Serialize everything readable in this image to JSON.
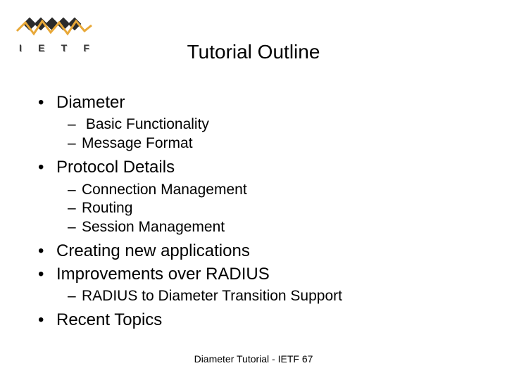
{
  "title": "Tutorial Outline",
  "logo_letters": [
    "I",
    "E",
    "T",
    "F"
  ],
  "bullets": [
    {
      "text": "Diameter",
      "sub": [
        " Basic Functionality",
        "Message Format"
      ]
    },
    {
      "text": "Protocol Details",
      "sub": [
        "Connection Management",
        "Routing",
        "Session Management"
      ]
    },
    {
      "text": "Creating new applications",
      "sub": []
    },
    {
      "text": "Improvements over RADIUS",
      "sub": [
        "RADIUS to Diameter Transition Support"
      ]
    },
    {
      "text": "Recent Topics",
      "sub": []
    }
  ],
  "footer": "Diameter Tutorial - IETF 67"
}
